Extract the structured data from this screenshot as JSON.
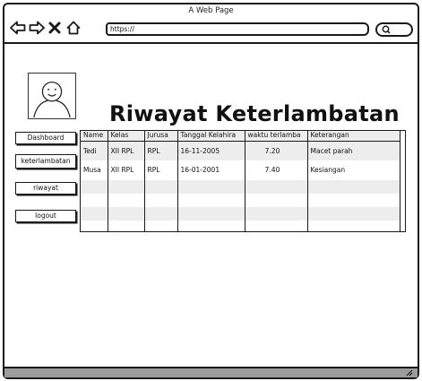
{
  "window": {
    "title": "A Web Page",
    "url": "https://"
  },
  "toolbar": {
    "icons": [
      "back-arrow-icon",
      "forward-arrow-icon",
      "close-icon",
      "home-icon",
      "search-icon"
    ]
  },
  "page": {
    "title": "Riwayat  Keterlambatan"
  },
  "sidebar": {
    "items": [
      {
        "label": "Dashboard"
      },
      {
        "label": "keterlambatan"
      },
      {
        "label": "riwayat"
      },
      {
        "label": "logout"
      }
    ]
  },
  "table": {
    "columns": [
      "Name",
      "Kelas",
      "Jurusa",
      "Tanggal Kelahira",
      "waktu terlamba",
      "Keterangan"
    ],
    "rows": [
      {
        "name": "Tedi",
        "kelas": "XII RPL",
        "jurusan": "RPL",
        "tanggal": "16-11-2005",
        "waktu": "7.20",
        "keterangan": "Macet parah"
      },
      {
        "name": "Musa",
        "kelas": "XII RPL",
        "jurusan": "RPL",
        "tanggal": "16-01-2001",
        "waktu": "7.40",
        "keterangan": "Kesiangan"
      }
    ]
  },
  "colors": {
    "stroke": "#1a1a1a",
    "row_shade": "#ededed",
    "statusbar": "#9c9c9c"
  }
}
